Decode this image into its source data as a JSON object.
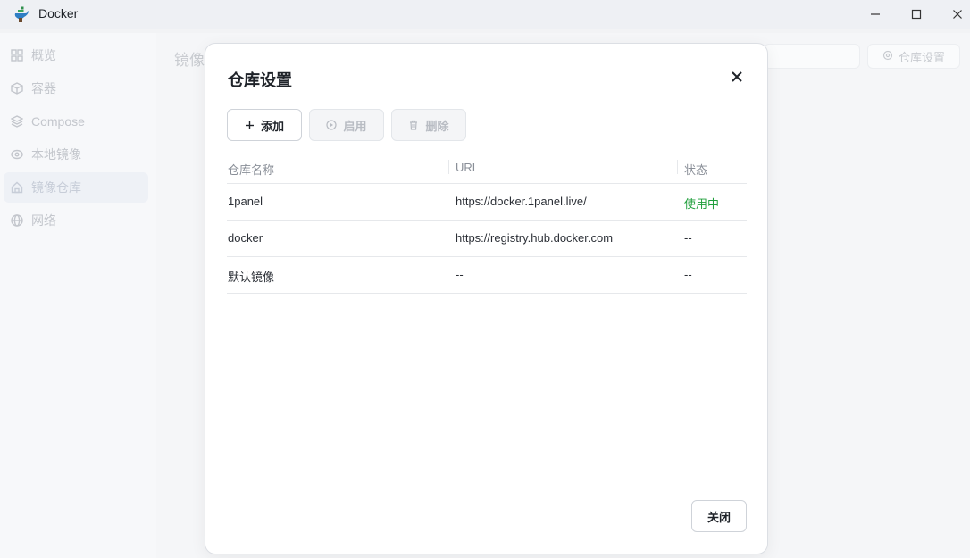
{
  "window": {
    "title": "Docker",
    "controls": [
      "minimize",
      "maximize",
      "close"
    ]
  },
  "sidebar": {
    "items": [
      {
        "label": "概览",
        "icon": "grid-icon",
        "active": false
      },
      {
        "label": "容器",
        "icon": "box-icon",
        "active": false
      },
      {
        "label": "Compose",
        "icon": "layers-icon",
        "active": false
      },
      {
        "label": "本地镜像",
        "icon": "disc-icon",
        "active": false
      },
      {
        "label": "镜像仓库",
        "icon": "home-icon",
        "active": true
      },
      {
        "label": "网络",
        "icon": "globe-icon",
        "active": false
      }
    ]
  },
  "main": {
    "title_partial": "镜像仓",
    "settings_button_label": "仓库设置"
  },
  "modal": {
    "title": "仓库设置",
    "toolbar": {
      "add_label": "添加",
      "enable_label": "启用",
      "delete_label": "删除"
    },
    "table": {
      "columns": [
        "仓库名称",
        "URL",
        "状态"
      ],
      "rows": [
        {
          "name": "1panel",
          "url": "https://docker.1panel.live/",
          "status": "使用中"
        },
        {
          "name": "docker",
          "url": "https://registry.hub.docker.com",
          "status": "--"
        },
        {
          "name": "默认镜像",
          "url": "--",
          "status": "--"
        }
      ]
    },
    "footer": {
      "close_label": "关闭"
    }
  },
  "colors": {
    "status_active": "#1e9e3a",
    "modal_background": "#ffffff",
    "page_background": "#f2f3f5"
  }
}
